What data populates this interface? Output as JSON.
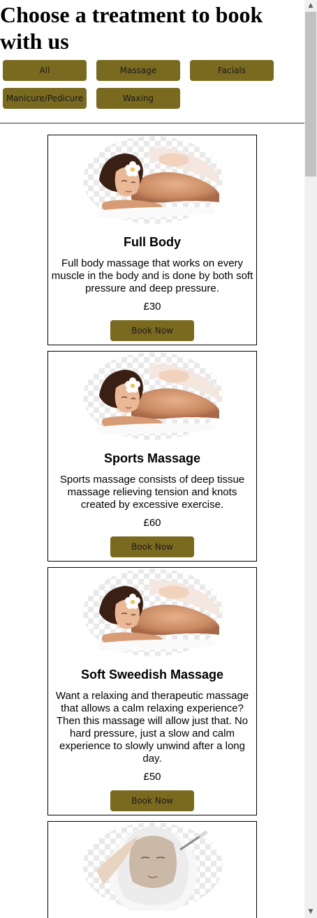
{
  "page": {
    "title": "Choose a treatment to book with us"
  },
  "filters": [
    {
      "label": "All"
    },
    {
      "label": "Massage"
    },
    {
      "label": "Facials"
    },
    {
      "label": "Manicure/Pedicure"
    },
    {
      "label": "Waxing"
    }
  ],
  "treatments": [
    {
      "image": "massage-photo",
      "title": "Full Body",
      "description": "Full body massage that works on every muscle in the body and is done by both soft pressure and deep pressure.",
      "price": "£30",
      "button": "Book Now"
    },
    {
      "image": "massage-photo",
      "title": "Sports Massage",
      "description": "Sports massage consists of deep tissue massage relieving tension and knots created by excessive exercise.",
      "price": "£60",
      "button": "Book Now"
    },
    {
      "image": "massage-photo",
      "title": "Soft Sweedish Massage",
      "description": "Want a relaxing and therapeutic massage that allows a calm relaxing experience? Then this massage will allow just that. No hard pressure, just a slow and calm experience to slowly unwind after a long day.",
      "price": "£50",
      "button": "Book Now"
    },
    {
      "image": "facial-photo"
    }
  ],
  "colors": {
    "button_bg": "#7a6a20",
    "scrollbar_track": "#f0f0f0",
    "scrollbar_thumb": "#c1c1c1"
  },
  "scrollbar": {
    "up_icon": "arrow-up-icon",
    "down_icon": "arrow-down-icon"
  }
}
